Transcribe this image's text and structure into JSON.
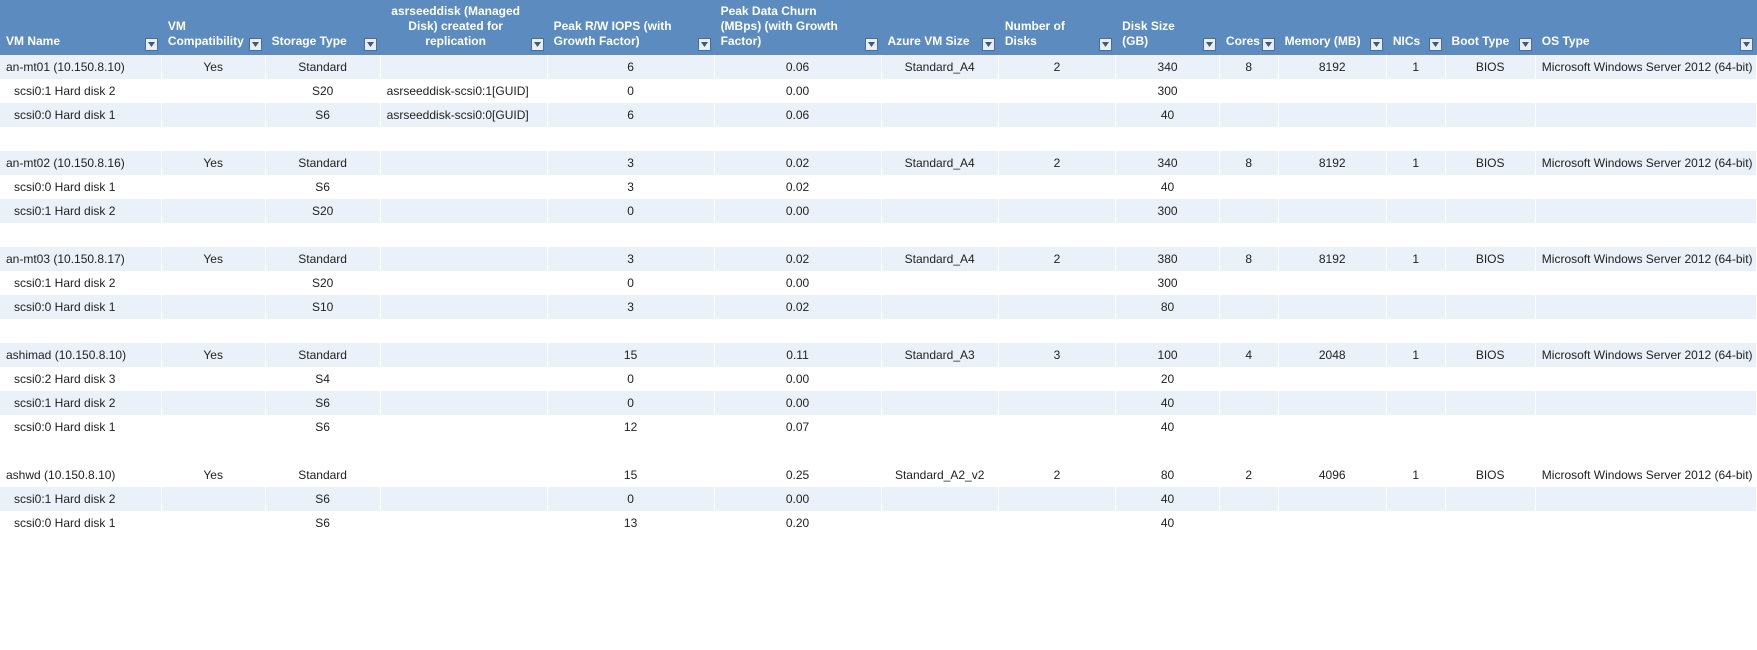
{
  "columns": [
    {
      "key": "vm_name",
      "label": "VM Name",
      "align": "l",
      "hdr_align": "left"
    },
    {
      "key": "compat",
      "label": "VM Compatibility",
      "align": "c",
      "hdr_align": "left"
    },
    {
      "key": "storage_type",
      "label": "Storage Type",
      "align": "c",
      "hdr_align": "left"
    },
    {
      "key": "asrseeddisk",
      "label": "asrseeddisk (Managed Disk) created for replication",
      "align": "l",
      "hdr_align": "center"
    },
    {
      "key": "peak_iops",
      "label": "Peak R/W IOPS (with Growth Factor)",
      "align": "c",
      "hdr_align": "left"
    },
    {
      "key": "peak_churn",
      "label": "Peak Data Churn (MBps) (with Growth Factor)",
      "align": "c",
      "hdr_align": "left"
    },
    {
      "key": "azure_size",
      "label": "Azure VM Size",
      "align": "c",
      "hdr_align": "left"
    },
    {
      "key": "num_disks",
      "label": "Number of Disks",
      "align": "c",
      "hdr_align": "left"
    },
    {
      "key": "disk_size",
      "label": "Disk Size (GB)",
      "align": "c",
      "hdr_align": "left"
    },
    {
      "key": "cores",
      "label": "Cores",
      "align": "c",
      "hdr_align": "left"
    },
    {
      "key": "memory",
      "label": "Memory (MB)",
      "align": "c",
      "hdr_align": "left"
    },
    {
      "key": "nics",
      "label": "NICs",
      "align": "c",
      "hdr_align": "left"
    },
    {
      "key": "boot_type",
      "label": "Boot Type",
      "align": "c",
      "hdr_align": "left"
    },
    {
      "key": "os_type",
      "label": "OS Type",
      "align": "l",
      "hdr_align": "left"
    }
  ],
  "rows": [
    {
      "stripe": "odd",
      "vm_name": "an-mt01 (10.150.8.10)",
      "compat": "Yes",
      "storage_type": "Standard",
      "asrseeddisk": "",
      "peak_iops": "6",
      "peak_churn": "0.06",
      "azure_size": "Standard_A4",
      "num_disks": "2",
      "disk_size": "340",
      "cores": "8",
      "memory": "8192",
      "nics": "1",
      "boot_type": "BIOS",
      "os_type": "Microsoft Windows Server 2012 (64-bit)"
    },
    {
      "stripe": "even",
      "indent": true,
      "vm_name": "scsi0:1 Hard disk 2",
      "compat": "",
      "storage_type": "S20",
      "asrseeddisk": "asrseeddisk-scsi0:1[GUID]",
      "peak_iops": "0",
      "peak_churn": "0.00",
      "azure_size": "",
      "num_disks": "",
      "disk_size": "300",
      "cores": "",
      "memory": "",
      "nics": "",
      "boot_type": "",
      "os_type": ""
    },
    {
      "stripe": "odd",
      "indent": true,
      "vm_name": "scsi0:0 Hard disk 1",
      "compat": "",
      "storage_type": "S6",
      "asrseeddisk": "asrseeddisk-scsi0:0[GUID]",
      "peak_iops": "6",
      "peak_churn": "0.06",
      "azure_size": "",
      "num_disks": "",
      "disk_size": "40",
      "cores": "",
      "memory": "",
      "nics": "",
      "boot_type": "",
      "os_type": ""
    },
    {
      "gap": true
    },
    {
      "stripe": "odd",
      "vm_name": "an-mt02 (10.150.8.16)",
      "compat": "Yes",
      "storage_type": "Standard",
      "asrseeddisk": "",
      "peak_iops": "3",
      "peak_churn": "0.02",
      "azure_size": "Standard_A4",
      "num_disks": "2",
      "disk_size": "340",
      "cores": "8",
      "memory": "8192",
      "nics": "1",
      "boot_type": "BIOS",
      "os_type": "Microsoft Windows Server 2012 (64-bit)"
    },
    {
      "stripe": "even",
      "indent": true,
      "vm_name": "scsi0:0 Hard disk 1",
      "compat": "",
      "storage_type": "S6",
      "asrseeddisk": "",
      "peak_iops": "3",
      "peak_churn": "0.02",
      "azure_size": "",
      "num_disks": "",
      "disk_size": "40",
      "cores": "",
      "memory": "",
      "nics": "",
      "boot_type": "",
      "os_type": ""
    },
    {
      "stripe": "odd",
      "indent": true,
      "vm_name": "scsi0:1 Hard disk 2",
      "compat": "",
      "storage_type": "S20",
      "asrseeddisk": "",
      "peak_iops": "0",
      "peak_churn": "0.00",
      "azure_size": "",
      "num_disks": "",
      "disk_size": "300",
      "cores": "",
      "memory": "",
      "nics": "",
      "boot_type": "",
      "os_type": ""
    },
    {
      "gap": true
    },
    {
      "stripe": "odd",
      "vm_name": "an-mt03 (10.150.8.17)",
      "compat": "Yes",
      "storage_type": "Standard",
      "asrseeddisk": "",
      "peak_iops": "3",
      "peak_churn": "0.02",
      "azure_size": "Standard_A4",
      "num_disks": "2",
      "disk_size": "380",
      "cores": "8",
      "memory": "8192",
      "nics": "1",
      "boot_type": "BIOS",
      "os_type": "Microsoft Windows Server 2012 (64-bit)"
    },
    {
      "stripe": "even",
      "indent": true,
      "vm_name": "scsi0:1 Hard disk 2",
      "compat": "",
      "storage_type": "S20",
      "asrseeddisk": "",
      "peak_iops": "0",
      "peak_churn": "0.00",
      "azure_size": "",
      "num_disks": "",
      "disk_size": "300",
      "cores": "",
      "memory": "",
      "nics": "",
      "boot_type": "",
      "os_type": ""
    },
    {
      "stripe": "odd",
      "indent": true,
      "vm_name": "scsi0:0 Hard disk 1",
      "compat": "",
      "storage_type": "S10",
      "asrseeddisk": "",
      "peak_iops": "3",
      "peak_churn": "0.02",
      "azure_size": "",
      "num_disks": "",
      "disk_size": "80",
      "cores": "",
      "memory": "",
      "nics": "",
      "boot_type": "",
      "os_type": ""
    },
    {
      "gap": true
    },
    {
      "stripe": "odd",
      "vm_name": "ashimad (10.150.8.10)",
      "compat": "Yes",
      "storage_type": "Standard",
      "asrseeddisk": "",
      "peak_iops": "15",
      "peak_churn": "0.11",
      "azure_size": "Standard_A3",
      "num_disks": "3",
      "disk_size": "100",
      "cores": "4",
      "memory": "2048",
      "nics": "1",
      "boot_type": "BIOS",
      "os_type": "Microsoft Windows Server 2012 (64-bit)"
    },
    {
      "stripe": "even",
      "indent": true,
      "vm_name": "scsi0:2 Hard disk 3",
      "compat": "",
      "storage_type": "S4",
      "asrseeddisk": "",
      "peak_iops": "0",
      "peak_churn": "0.00",
      "azure_size": "",
      "num_disks": "",
      "disk_size": "20",
      "cores": "",
      "memory": "",
      "nics": "",
      "boot_type": "",
      "os_type": ""
    },
    {
      "stripe": "odd",
      "indent": true,
      "vm_name": "scsi0:1 Hard disk 2",
      "compat": "",
      "storage_type": "S6",
      "asrseeddisk": "",
      "peak_iops": "0",
      "peak_churn": "0.00",
      "azure_size": "",
      "num_disks": "",
      "disk_size": "40",
      "cores": "",
      "memory": "",
      "nics": "",
      "boot_type": "",
      "os_type": ""
    },
    {
      "stripe": "even",
      "indent": true,
      "vm_name": "scsi0:0 Hard disk 1",
      "compat": "",
      "storage_type": "S6",
      "asrseeddisk": "",
      "peak_iops": "12",
      "peak_churn": "0.07",
      "azure_size": "",
      "num_disks": "",
      "disk_size": "40",
      "cores": "",
      "memory": "",
      "nics": "",
      "boot_type": "",
      "os_type": ""
    },
    {
      "gap": true
    },
    {
      "stripe": "even",
      "vm_name": "ashwd (10.150.8.10)",
      "compat": "Yes",
      "storage_type": "Standard",
      "asrseeddisk": "",
      "peak_iops": "15",
      "peak_churn": "0.25",
      "azure_size": "Standard_A2_v2",
      "num_disks": "2",
      "disk_size": "80",
      "cores": "2",
      "memory": "4096",
      "nics": "1",
      "boot_type": "BIOS",
      "os_type": "Microsoft Windows Server 2012 (64-bit)"
    },
    {
      "stripe": "odd",
      "indent": true,
      "vm_name": "scsi0:1 Hard disk 2",
      "compat": "",
      "storage_type": "S6",
      "asrseeddisk": "",
      "peak_iops": "0",
      "peak_churn": "0.00",
      "azure_size": "",
      "num_disks": "",
      "disk_size": "40",
      "cores": "",
      "memory": "",
      "nics": "",
      "boot_type": "",
      "os_type": ""
    },
    {
      "stripe": "even",
      "indent": true,
      "vm_name": "scsi0:0 Hard disk 1",
      "compat": "",
      "storage_type": "S6",
      "asrseeddisk": "",
      "peak_iops": "13",
      "peak_churn": "0.20",
      "azure_size": "",
      "num_disks": "",
      "disk_size": "40",
      "cores": "",
      "memory": "",
      "nics": "",
      "boot_type": "",
      "os_type": ""
    },
    {
      "gap": true
    }
  ]
}
